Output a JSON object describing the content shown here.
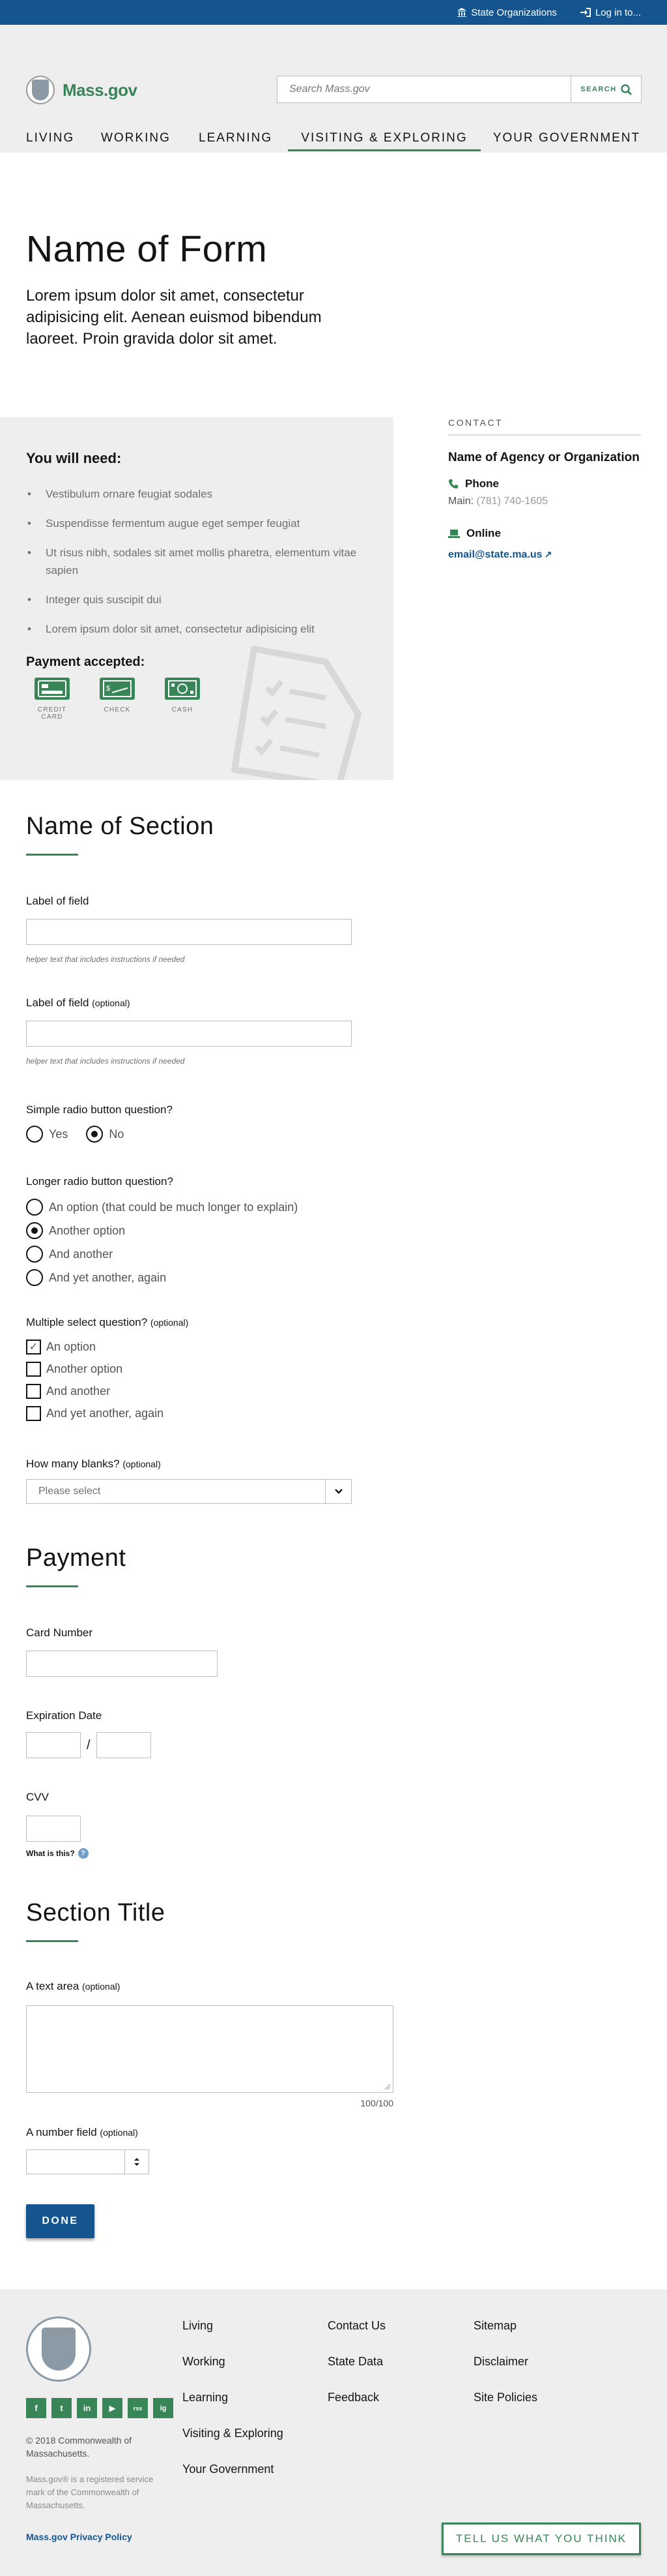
{
  "utility": {
    "state_orgs": "State Organizations",
    "login": "Log in to..."
  },
  "header": {
    "logo_text": "Mass.gov",
    "search_placeholder": "Search Mass.gov",
    "search_button": "SEARCH",
    "nav": [
      "LIVING",
      "WORKING",
      "LEARNING",
      "VISITING & EXPLORING",
      "YOUR GOVERNMENT"
    ]
  },
  "page": {
    "title": "Name of Form",
    "lede": "Lorem ipsum dolor sit amet, consectetur adipisicing elit. Aenean euismod bibendum laoreet. Proin gravida dolor sit amet."
  },
  "needs": {
    "heading": "You will need",
    "heading_suffix": ":",
    "items": [
      "Vestibulum ornare feugiat sodales",
      "Suspendisse fermentum augue eget semper feugiat",
      "Ut risus nibh, sodales sit amet mollis pharetra, elementum vitae sapien",
      "Integer quis suscipit dui",
      "Lorem ipsum dolor sit amet, consectetur adipisicing elit"
    ],
    "payment_heading": "Payment accepted",
    "payment_methods": [
      "CREDIT CARD",
      "CHECK",
      "CASH"
    ]
  },
  "contact": {
    "label": "CONTACT",
    "org": "Name of Agency or Organization",
    "phone_label": "Phone",
    "phone_main_label": "Main:",
    "phone_number": "(781) 740-1605",
    "online_label": "Online",
    "email": "email@state.ma.us"
  },
  "form1": {
    "title": "Name of Section",
    "field1_label": "Label of field",
    "field1_helper": "helper text that includes instructions if needed",
    "field2_label": "Label of field",
    "field2_optional": "(optional)",
    "field2_helper": "helper text that includes instructions if needed",
    "simple_radio_label": "Simple radio button question?",
    "simple_radio_options": [
      "Yes",
      "No"
    ],
    "long_radio_label": "Longer radio button question?",
    "long_radio_options": [
      "An option (that could be much longer to explain)",
      "Another option",
      "And another",
      "And yet another, again"
    ],
    "multi_label": "Multiple select question?",
    "multi_optional": "(optional)",
    "multi_options": [
      "An option",
      "Another option",
      "And another",
      "And yet another, again"
    ],
    "blanks_label": "How many blanks?",
    "blanks_optional": "(optional)",
    "blanks_value": "Please select"
  },
  "payment": {
    "title": "Payment",
    "card_label": "Card Number",
    "exp_label": "Expiration Date",
    "exp_sep": "/",
    "cvv_label": "CVV",
    "what_is_this": "What is this?"
  },
  "section3": {
    "title": "Section Title",
    "textarea_label": "A text area",
    "textarea_optional": "(optional)",
    "counter": "100/100",
    "number_label": "A number field",
    "number_optional": "(optional)",
    "done": "DONE"
  },
  "footer": {
    "col1": [
      "Living",
      "Working",
      "Learning",
      "Visiting & Exploring",
      "Your Government"
    ],
    "col2": [
      "Contact Us",
      "State Data",
      "Feedback"
    ],
    "col3": [
      "Sitemap",
      "Disclaimer",
      "Site Policies"
    ],
    "social": [
      "f",
      "t",
      "in",
      "▶",
      "rss",
      "ig"
    ],
    "copyright": "© 2018 Commonwealth of Massachusetts.",
    "trademark": "Mass.gov® is a registered service mark of the Commonwealth of Massachusetts.",
    "privacy": "Mass.gov Privacy Policy",
    "feedback_btn": "TELL US WHAT YOU THINK"
  },
  "colors": {
    "blue": "#14558f",
    "green": "#388557",
    "gray_bg": "#eeeeee"
  }
}
